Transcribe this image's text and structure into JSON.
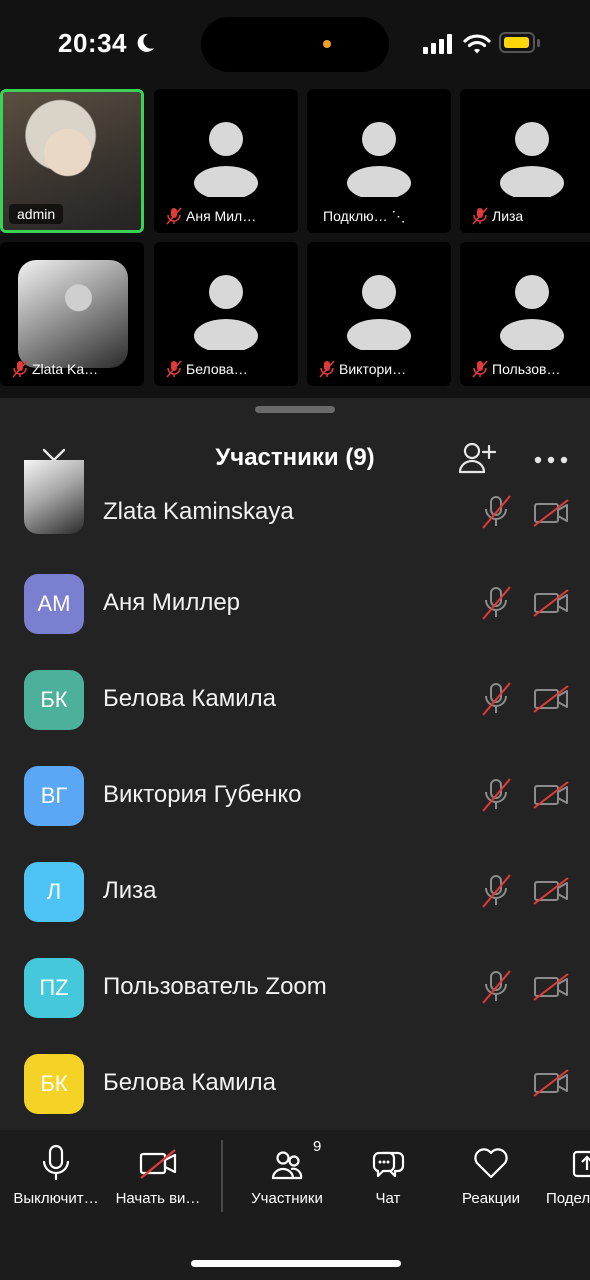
{
  "status_bar": {
    "time": "20:34"
  },
  "video_grid": {
    "tiles": [
      {
        "name": "admin",
        "muted": false,
        "active": true
      },
      {
        "name": "Аня Мил…",
        "muted": true
      },
      {
        "name": "Подклю… ⋱",
        "muted": false
      },
      {
        "name": "Лиза",
        "muted": true
      },
      {
        "name": "Zlata Ka…",
        "muted": true
      },
      {
        "name": "Белова…",
        "muted": true
      },
      {
        "name": "Виктори…",
        "muted": true
      },
      {
        "name": "Пользов…",
        "muted": true
      }
    ]
  },
  "sheet": {
    "title": "Участники (9)",
    "participants": [
      {
        "name": "Zlata Kaminskaya",
        "initials": "",
        "color": "#ffffff",
        "photo": true,
        "mic_muted": true,
        "cam_off": true
      },
      {
        "name": "Аня Миллер",
        "initials": "АМ",
        "color": "#7b7fd0",
        "mic_muted": true,
        "cam_off": true
      },
      {
        "name": "Белова Камила",
        "initials": "БК",
        "color": "#4db09b",
        "mic_muted": true,
        "cam_off": true
      },
      {
        "name": "Виктория Губенко",
        "initials": "ВГ",
        "color": "#5aa8f5",
        "mic_muted": true,
        "cam_off": true
      },
      {
        "name": "Лиза",
        "initials": "Л",
        "color": "#4ec3f5",
        "mic_muted": true,
        "cam_off": true
      },
      {
        "name": "Пользователь Zoom",
        "initials": "ПZ",
        "color": "#45c8db",
        "mic_muted": true,
        "cam_off": true
      },
      {
        "name": "Белова Камила",
        "initials": "БК",
        "color": "#f5d326",
        "mic_muted": null,
        "cam_off": true
      }
    ]
  },
  "toolbar": {
    "mute_label": "Выключит…",
    "video_label": "Начать ви…",
    "participants_label": "Участники",
    "participants_count": "9",
    "chat_label": "Чат",
    "reactions_label": "Реакции",
    "share_label": "Подел"
  }
}
